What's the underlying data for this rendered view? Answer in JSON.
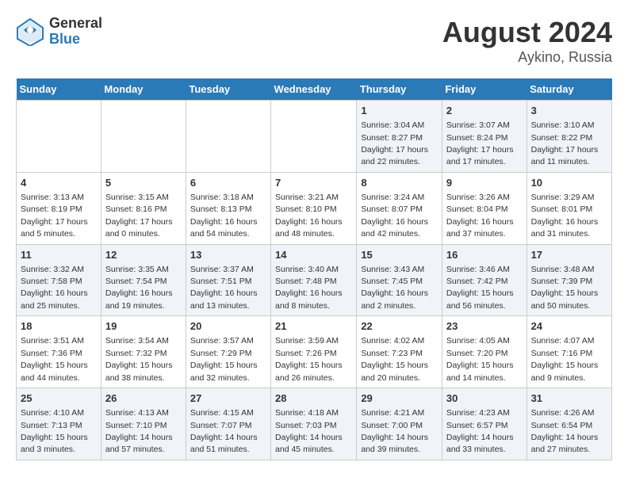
{
  "header": {
    "logo_line1": "General",
    "logo_line2": "Blue",
    "title": "August 2024",
    "subtitle": "Aykino, Russia"
  },
  "days_of_week": [
    "Sunday",
    "Monday",
    "Tuesday",
    "Wednesday",
    "Thursday",
    "Friday",
    "Saturday"
  ],
  "weeks": [
    [
      {
        "day": "",
        "info": ""
      },
      {
        "day": "",
        "info": ""
      },
      {
        "day": "",
        "info": ""
      },
      {
        "day": "",
        "info": ""
      },
      {
        "day": "1",
        "info": "Sunrise: 3:04 AM\nSunset: 8:27 PM\nDaylight: 17 hours\nand 22 minutes."
      },
      {
        "day": "2",
        "info": "Sunrise: 3:07 AM\nSunset: 8:24 PM\nDaylight: 17 hours\nand 17 minutes."
      },
      {
        "day": "3",
        "info": "Sunrise: 3:10 AM\nSunset: 8:22 PM\nDaylight: 17 hours\nand 11 minutes."
      }
    ],
    [
      {
        "day": "4",
        "info": "Sunrise: 3:13 AM\nSunset: 8:19 PM\nDaylight: 17 hours\nand 5 minutes."
      },
      {
        "day": "5",
        "info": "Sunrise: 3:15 AM\nSunset: 8:16 PM\nDaylight: 17 hours\nand 0 minutes."
      },
      {
        "day": "6",
        "info": "Sunrise: 3:18 AM\nSunset: 8:13 PM\nDaylight: 16 hours\nand 54 minutes."
      },
      {
        "day": "7",
        "info": "Sunrise: 3:21 AM\nSunset: 8:10 PM\nDaylight: 16 hours\nand 48 minutes."
      },
      {
        "day": "8",
        "info": "Sunrise: 3:24 AM\nSunset: 8:07 PM\nDaylight: 16 hours\nand 42 minutes."
      },
      {
        "day": "9",
        "info": "Sunrise: 3:26 AM\nSunset: 8:04 PM\nDaylight: 16 hours\nand 37 minutes."
      },
      {
        "day": "10",
        "info": "Sunrise: 3:29 AM\nSunset: 8:01 PM\nDaylight: 16 hours\nand 31 minutes."
      }
    ],
    [
      {
        "day": "11",
        "info": "Sunrise: 3:32 AM\nSunset: 7:58 PM\nDaylight: 16 hours\nand 25 minutes."
      },
      {
        "day": "12",
        "info": "Sunrise: 3:35 AM\nSunset: 7:54 PM\nDaylight: 16 hours\nand 19 minutes."
      },
      {
        "day": "13",
        "info": "Sunrise: 3:37 AM\nSunset: 7:51 PM\nDaylight: 16 hours\nand 13 minutes."
      },
      {
        "day": "14",
        "info": "Sunrise: 3:40 AM\nSunset: 7:48 PM\nDaylight: 16 hours\nand 8 minutes."
      },
      {
        "day": "15",
        "info": "Sunrise: 3:43 AM\nSunset: 7:45 PM\nDaylight: 16 hours\nand 2 minutes."
      },
      {
        "day": "16",
        "info": "Sunrise: 3:46 AM\nSunset: 7:42 PM\nDaylight: 15 hours\nand 56 minutes."
      },
      {
        "day": "17",
        "info": "Sunrise: 3:48 AM\nSunset: 7:39 PM\nDaylight: 15 hours\nand 50 minutes."
      }
    ],
    [
      {
        "day": "18",
        "info": "Sunrise: 3:51 AM\nSunset: 7:36 PM\nDaylight: 15 hours\nand 44 minutes."
      },
      {
        "day": "19",
        "info": "Sunrise: 3:54 AM\nSunset: 7:32 PM\nDaylight: 15 hours\nand 38 minutes."
      },
      {
        "day": "20",
        "info": "Sunrise: 3:57 AM\nSunset: 7:29 PM\nDaylight: 15 hours\nand 32 minutes."
      },
      {
        "day": "21",
        "info": "Sunrise: 3:59 AM\nSunset: 7:26 PM\nDaylight: 15 hours\nand 26 minutes."
      },
      {
        "day": "22",
        "info": "Sunrise: 4:02 AM\nSunset: 7:23 PM\nDaylight: 15 hours\nand 20 minutes."
      },
      {
        "day": "23",
        "info": "Sunrise: 4:05 AM\nSunset: 7:20 PM\nDaylight: 15 hours\nand 14 minutes."
      },
      {
        "day": "24",
        "info": "Sunrise: 4:07 AM\nSunset: 7:16 PM\nDaylight: 15 hours\nand 9 minutes."
      }
    ],
    [
      {
        "day": "25",
        "info": "Sunrise: 4:10 AM\nSunset: 7:13 PM\nDaylight: 15 hours\nand 3 minutes."
      },
      {
        "day": "26",
        "info": "Sunrise: 4:13 AM\nSunset: 7:10 PM\nDaylight: 14 hours\nand 57 minutes."
      },
      {
        "day": "27",
        "info": "Sunrise: 4:15 AM\nSunset: 7:07 PM\nDaylight: 14 hours\nand 51 minutes."
      },
      {
        "day": "28",
        "info": "Sunrise: 4:18 AM\nSunset: 7:03 PM\nDaylight: 14 hours\nand 45 minutes."
      },
      {
        "day": "29",
        "info": "Sunrise: 4:21 AM\nSunset: 7:00 PM\nDaylight: 14 hours\nand 39 minutes."
      },
      {
        "day": "30",
        "info": "Sunrise: 4:23 AM\nSunset: 6:57 PM\nDaylight: 14 hours\nand 33 minutes."
      },
      {
        "day": "31",
        "info": "Sunrise: 4:26 AM\nSunset: 6:54 PM\nDaylight: 14 hours\nand 27 minutes."
      }
    ]
  ]
}
